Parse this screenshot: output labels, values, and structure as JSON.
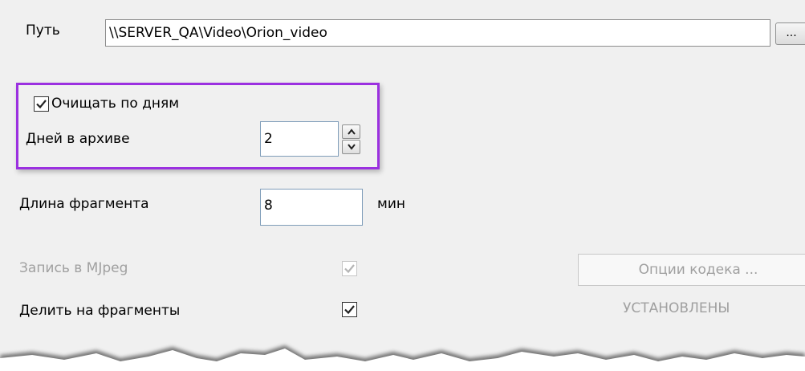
{
  "path": {
    "label": "Путь",
    "value": "\\\\SERVER_QA\\Video\\Orion_video",
    "browse_label": "..."
  },
  "cleanup": {
    "checkbox_label": "Очищать по  дням",
    "checked": true,
    "days_label": "Дней в архиве",
    "days_value": "2"
  },
  "fragment": {
    "label": "Длина фрагмента",
    "value": "8",
    "unit": "мин"
  },
  "mjpeg": {
    "label": "Запись в MJpeg",
    "checked": true,
    "disabled": true
  },
  "split": {
    "label": "Делить на фрагменты",
    "checked": true
  },
  "codec": {
    "button_label": "Опции кодека ...",
    "status": "УСТАНОВЛЕНЫ"
  },
  "colors": {
    "highlight": "#9b30e0",
    "disabled_text": "#a0a0a0"
  }
}
